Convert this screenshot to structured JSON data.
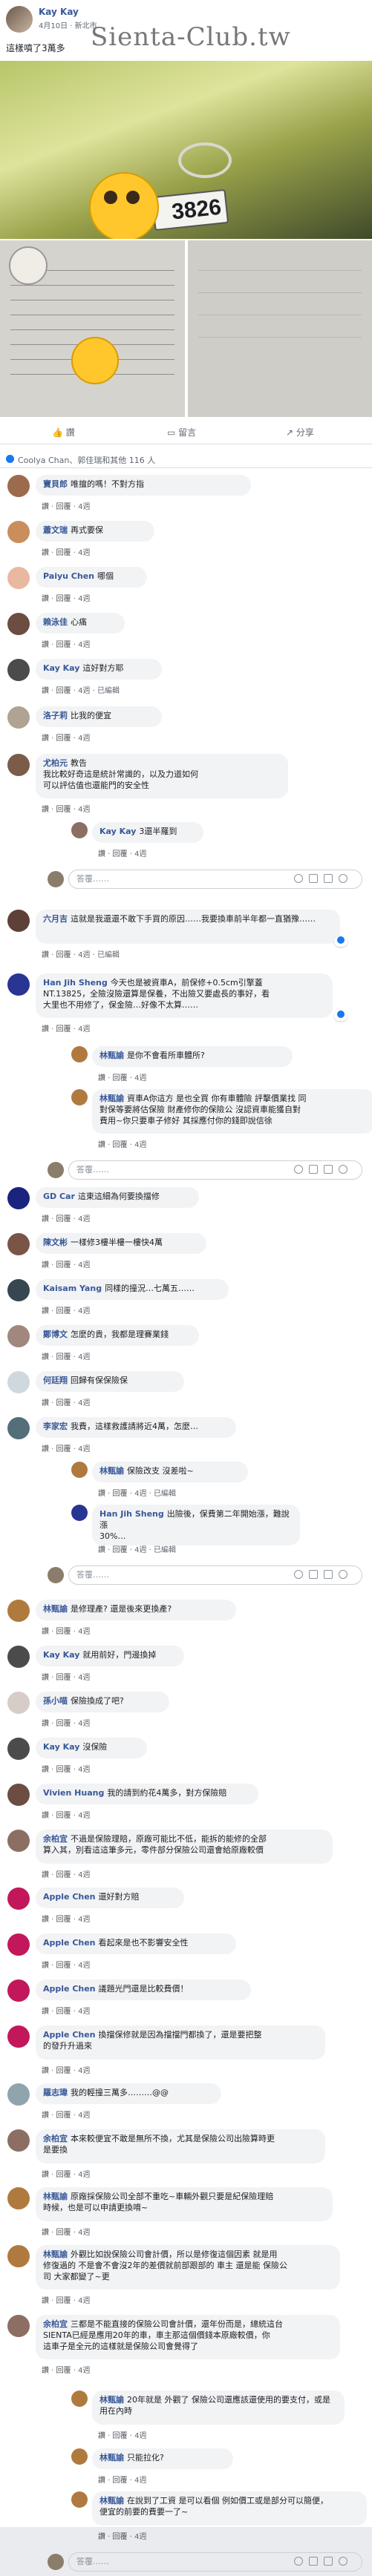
{
  "post": {
    "author": "Kay Kay",
    "meta": "4月10日 · 新北市",
    "text": "這樣噴了3萬多",
    "watermark": "Sienta-Club.tw",
    "plate": "3826"
  },
  "actions": {
    "like": "讚",
    "comment": "留言",
    "share": "分享"
  },
  "summary": "Coolya Chan、郭佳瑞和其他 116 人",
  "reply_placeholder": "答覆……",
  "act": {
    "like": "讚",
    "reply": "回覆"
  },
  "comments": [
    {
      "name": "寶貝郎",
      "text": "唯擅的嗎！不對方指",
      "time": "4週"
    },
    {
      "name": "蕭文瑞",
      "text": "再式要保",
      "time": "4週"
    },
    {
      "name": "Paiyu Chen",
      "text": "哪個",
      "time": "4週"
    },
    {
      "name": "賴泳佳",
      "text": "心痛",
      "time": "4週"
    },
    {
      "name": "Kay Kay",
      "text": "這好對方耶",
      "time": "4週 · 已編輯"
    },
    {
      "name": "洛子莉",
      "text": "比我的便宜",
      "time": "4週"
    },
    {
      "name": "尤柏元",
      "text": "教告\n我比較好奇這是統計常識的，以及力道如何\n可以評估值也還能門的安全性",
      "time": "4週"
    },
    {
      "name": "Kay Kay",
      "text": "3還半羅到",
      "time": "4週"
    },
    {
      "name": "六月吉",
      "text": "這就是我還還不敢下手買的原因……我要換車前半年都一直猶豫……",
      "time": "4週 · 已編輯"
    },
    {
      "name": "Han Jih Sheng",
      "text": "今天也是被資車A，前保修+0.5cm引擎蓋\nNT.13825，全險沒險還算是保養，不出險又要處長的事好，看\n大里也不用修了，保金險…好像不太算……",
      "time": "4週"
    },
    {
      "name": "林甄諭",
      "text": "是你不會看所車體所?",
      "time": "4週"
    },
    {
      "name": "林甄諭",
      "text": "資車A你這方 是也全買 你有車體險 評擊價業找 同\n對保等要將估保險 財產修你的保險公 沒認資車能獲自對\n費用~你只要車子修好 其採應付你的錢即說信徐",
      "time": "4週"
    },
    {
      "name": "GD Car",
      "text": "這東這細為何要換擋修",
      "time": "4週"
    },
    {
      "name": "陳文彬",
      "text": "一樣修3樓半樓一樓快4萬",
      "time": "4週"
    },
    {
      "name": "Kaisam Yang",
      "text": "同樣的撞況…七萬五……",
      "time": "4週"
    },
    {
      "name": "鄭博文",
      "text": "怎麼的貴，我都是理賽業錢",
      "time": "4週"
    },
    {
      "name": "何廷翔",
      "text": "回歸有保保險保",
      "time": "4週"
    },
    {
      "name": "李家宏",
      "text": "我費，這樣救護請將近4萬，怎麼…",
      "time": "4週"
    },
    {
      "name": "林甄諭",
      "text": "保險改支 沒差啦~",
      "time": "4週 · 已編輯"
    },
    {
      "name": "Han Jih Sheng",
      "text": "出險後，保費第二年開始漲，難說漲\n30%…",
      "time": "4週 · 已編輯"
    },
    {
      "name": "林甄諭",
      "text": "是修理產? 還是後來更換產?",
      "time": "4週"
    },
    {
      "name": "Kay Kay",
      "text": "就用前好，門邊換掉",
      "time": "4週"
    },
    {
      "name": "孫小喵",
      "text": "保險換成了吧?",
      "time": "4週"
    },
    {
      "name": "Kay Kay",
      "text": "沒保險",
      "time": "4週"
    },
    {
      "name": "Vivien Huang",
      "text": "我的請到約花4萬多，對方保險賠",
      "time": "4週"
    },
    {
      "name": "余柏宜",
      "text": "不過是保險理賠，原廠可能比不低，能拆的能修的全部\n算入其，別看這這筆多元，零件部分保險公司還會給原廠較價",
      "time": "4週"
    },
    {
      "name": "Apple Chen",
      "text": "還好對方賠",
      "time": "4週"
    },
    {
      "name": "Apple Chen",
      "text": "看起來是也不影響安全性",
      "time": "4週"
    },
    {
      "name": "Apple Chen",
      "text": "議題光門還是比較費價！",
      "time": "4週"
    },
    {
      "name": "Apple Chen",
      "text": "換擋保修就是因為擋擋門都換了，還是要把整\n的發升升過來",
      "time": "4週"
    },
    {
      "name": "羅志瑋",
      "text": "我的輕撞三萬多………@@",
      "time": "4週"
    },
    {
      "name": "余柏宜",
      "text": "本來較便宜不敢是無所不換，尤其是保險公司出險算時更\n是要換",
      "time": "4週"
    },
    {
      "name": "林甄諭",
      "text": "原廠採保險公司全部不重吃~車輛外觀只要是紀保險理賠\n時候，也是可以申請更換唷~",
      "time": "4週"
    },
    {
      "name": "林甄諭",
      "text": "外觀比如說保險公司會計價，所以是修復這個因素 就是用\n修復過的 不是會不會沒2年的差價就前部跟部的 車主 還是能 保險公\n司 大家都變了~更",
      "time": "4週"
    },
    {
      "name": "余柏宜",
      "text": "三都是不能直接的保險公司會計價，還年份而是，總統這台\nSIENTA已經是應用20年的車，車主那這個價錢本原廠較價，你\n這車子是全元的這樣就是保險公司會覺得了",
      "time": "4週"
    },
    {
      "name": "林甄諭",
      "text": "20年就是 外觀了 保險公司還應該還使用的要支付，或是\n用在內時",
      "time": "4週"
    },
    {
      "name": "林甄諭",
      "text": "只能拉化?",
      "time": "4週"
    },
    {
      "name": "林甄諭",
      "text": "在說到了工資 是可以看個 例如價工或是部分可以簡便，\n便宜的前要的費要一了~",
      "time": "4週"
    }
  ]
}
